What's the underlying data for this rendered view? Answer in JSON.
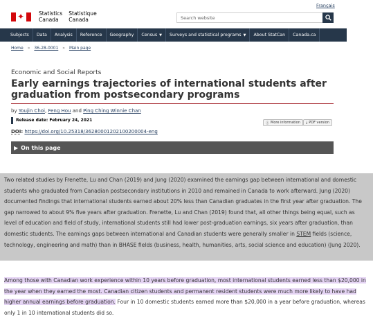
{
  "header": {
    "language_link": "Français",
    "signature": {
      "en_line1": "Statistics",
      "en_line2": "Canada",
      "fr_line1": "Statistique",
      "fr_line2": "Canada"
    },
    "search_placeholder": "Search website"
  },
  "nav": {
    "items": [
      {
        "label": "Subjects"
      },
      {
        "label": "Data"
      },
      {
        "label": "Analysis"
      },
      {
        "label": "Reference"
      },
      {
        "label": "Geography"
      },
      {
        "label": "Census",
        "dropdown": true
      },
      {
        "label": "Surveys and statistical programs",
        "dropdown": true
      },
      {
        "label": "About StatCan"
      },
      {
        "label": "Canada.ca"
      }
    ]
  },
  "breadcrumb": {
    "items": [
      "Home",
      "36-28-0001",
      "Main page"
    ]
  },
  "article": {
    "eyebrow": "Economic and Social Reports",
    "title": "Early earnings trajectories of international students after graduation from postsecondary programs",
    "by_label": "by",
    "authors": [
      "Youjin Choi",
      "Feng Hou",
      "Ping Ching Winnie Chan"
    ],
    "and_label": "and",
    "release_label": "Release date: February 24, 2021",
    "more_info_label": "More information",
    "pdf_label": "PDF version",
    "doi_label": "DOI",
    "doi_link": "https://doi.org/10.25318/36280001202100200004-eng",
    "toc_label": "On this page"
  },
  "paragraph1": {
    "before_stem": "Two related studies by Frenette, Lu and Chan (2019) and Jung (2020) examined the earnings gap between international and domestic students who graduated from Canadian postsecondary institutions in 2010 and remained in Canada to work afterward. Jung (2020) documented findings that international students earned about 20% less than Canadian graduates in the first year after graduation. The gap narrowed to about 9% five years after graduation. Frenette, Lu and Chan (2019) found that, all other things being equal, such as level of education and field of study, international students still had lower post-graduation earnings, six years after graduation, than domestic students. The earnings gaps between international and Canadian students were generally smaller in ",
    "stem": "STEM",
    "after_stem": " fields (science, technology, engineering and math) than in BHASE fields (business, health, humanities, arts, social science and education) (Jung 2020)."
  },
  "paragraph2": {
    "highlighted": "Among those with Canadian work experience within 10 years before graduation, most international students earned less than $20,000 in the year when they earned the most. Canadian citizen students and permanent resident students were much more likely to have had higher annual earnings before graduation.",
    "rest": " Four in 10 domestic students earned more than $20,000 in a year before graduation, whereas only 1 in 10 international students did so."
  },
  "colors": {
    "nav_bg": "#26374a",
    "toc_bg": "#555555",
    "title_rule": "#af3c43",
    "highlight": "#e4d3f3",
    "para1_bg": "#c8c8c8"
  }
}
